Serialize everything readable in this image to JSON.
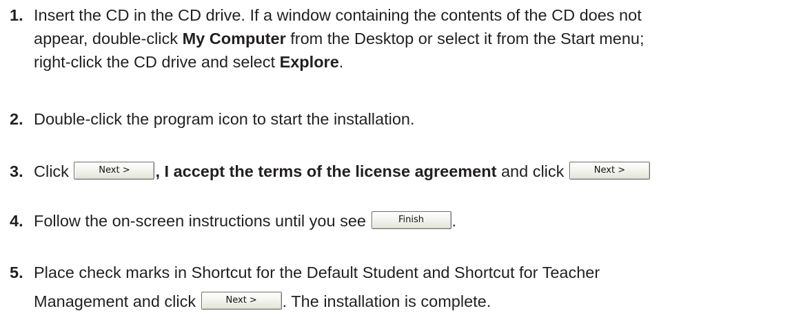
{
  "steps": [
    {
      "number": "1.",
      "lines": [
        {
          "text": "Insert the CD in the CD drive. If a window containing the contents of the CD does not"
        },
        {
          "pre": "appear, double-click ",
          "bold": "My Computer",
          "post": " from the Desktop or select it from the Start menu;"
        },
        {
          "pre": "right-click the CD drive and select ",
          "bold": "Explore",
          "post": "."
        }
      ]
    },
    {
      "number": "2.",
      "text": "Double-click the program icon to start the installation."
    },
    {
      "number": "3.",
      "pre": "Click ",
      "button1": "Next >",
      "mid_bold": ", I accept the terms of the license agreement",
      "mid": " and click ",
      "button2": "Next >"
    },
    {
      "number": "4.",
      "pre": "Follow the on-screen instructions until you see ",
      "button": "Finish",
      "post": "."
    },
    {
      "number": "5.",
      "line1": "Place check marks in Shortcut for the Default Student and Shortcut for Teacher",
      "line2_pre": "Management and click ",
      "button": "Next >",
      "line2_post": ". The installation is complete."
    }
  ]
}
